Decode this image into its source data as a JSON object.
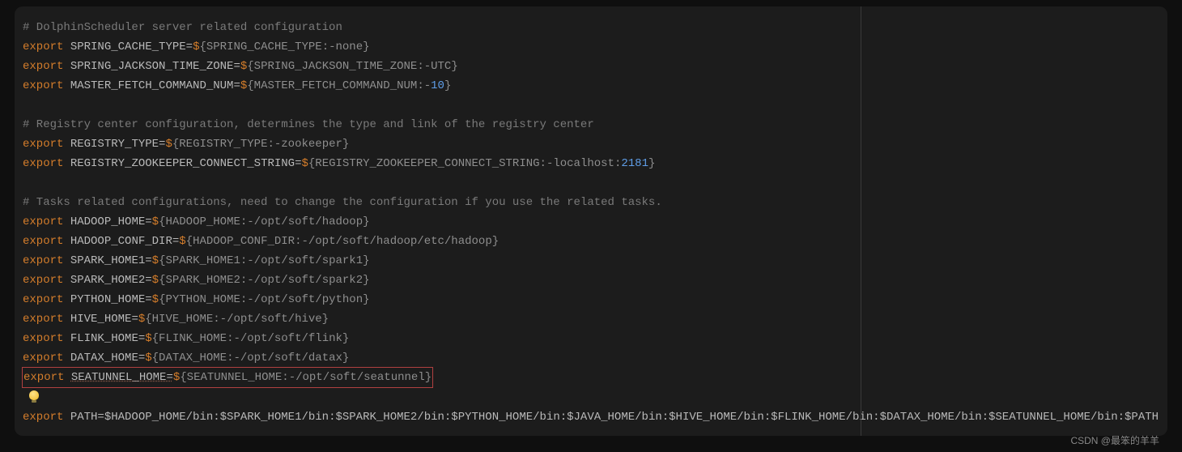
{
  "code": {
    "l1": "# DolphinScheduler server related configuration",
    "l2_kw": "export",
    "l2_var": "SPRING_CACHE_TYPE=",
    "l2_d": "$",
    "l2_body": "{SPRING_CACHE_TYPE:-none}",
    "l3_kw": "export",
    "l3_var": "SPRING_JACKSON_TIME_ZONE=",
    "l3_d": "$",
    "l3_body": "{SPRING_JACKSON_TIME_ZONE:-UTC}",
    "l4_kw": "export",
    "l4_var": "MASTER_FETCH_COMMAND_NUM=",
    "l4_d": "$",
    "l4_body1": "{MASTER_FETCH_COMMAND_NUM:-",
    "l4_num": "10",
    "l4_body2": "}",
    "l6": "# Registry center configuration, determines the type and link of the registry center",
    "l7_kw": "export",
    "l7_var": "REGISTRY_TYPE=",
    "l7_d": "$",
    "l7_body": "{REGISTRY_TYPE:-zookeeper}",
    "l8_kw": "export",
    "l8_var": "REGISTRY_ZOOKEEPER_CONNECT_STRING=",
    "l8_d": "$",
    "l8_body1": "{REGISTRY_ZOOKEEPER_CONNECT_STRING:-localhost:",
    "l8_num": "2181",
    "l8_body2": "}",
    "l10": "# Tasks related configurations, need to change the configuration if you use the related tasks.",
    "l11_kw": "export",
    "l11_var": "HADOOP_HOME=",
    "l11_d": "$",
    "l11_body": "{HADOOP_HOME:-/opt/soft/hadoop}",
    "l12_kw": "export",
    "l12_var": "HADOOP_CONF_DIR=",
    "l12_d": "$",
    "l12_body": "{HADOOP_CONF_DIR:-/opt/soft/hadoop/etc/hadoop}",
    "l13_kw": "export",
    "l13_var": "SPARK_HOME1=",
    "l13_d": "$",
    "l13_body": "{SPARK_HOME1:-/opt/soft/spark1}",
    "l14_kw": "export",
    "l14_var": "SPARK_HOME2=",
    "l14_d": "$",
    "l14_body": "{SPARK_HOME2:-/opt/soft/spark2}",
    "l15_kw": "export",
    "l15_var": "PYTHON_HOME=",
    "l15_d": "$",
    "l15_body": "{PYTHON_HOME:-/opt/soft/python}",
    "l16_kw": "export",
    "l16_var": "HIVE_HOME=",
    "l16_d": "$",
    "l16_body": "{HIVE_HOME:-/opt/soft/hive}",
    "l17_kw": "export",
    "l17_var": "FLINK_HOME=",
    "l17_d": "$",
    "l17_body": "{FLINK_HOME:-/opt/soft/flink}",
    "l18_kw": "export",
    "l18_var": "DATAX_HOME=",
    "l18_d": "$",
    "l18_body": "{DATAX_HOME:-/opt/soft/datax}",
    "l19_kw": "export",
    "l19_var": "SEATUNNEL_HOME=",
    "l19_d": "$",
    "l19_body": "{SEATUNNEL_HOME:-/opt/soft/seatunnel}",
    "l21_kw": "export",
    "l21_rest": " PATH=$HADOOP_HOME/bin:$SPARK_HOME1/bin:$SPARK_HOME2/bin:$PYTHON_HOME/bin:$JAVA_HOME/bin:$HIVE_HOME/bin:$FLINK_HOME/bin:$DATAX_HOME/bin:$SEATUNNEL_HOME/bin:$PATH"
  },
  "watermark": "CSDN @最笨的羊羊"
}
